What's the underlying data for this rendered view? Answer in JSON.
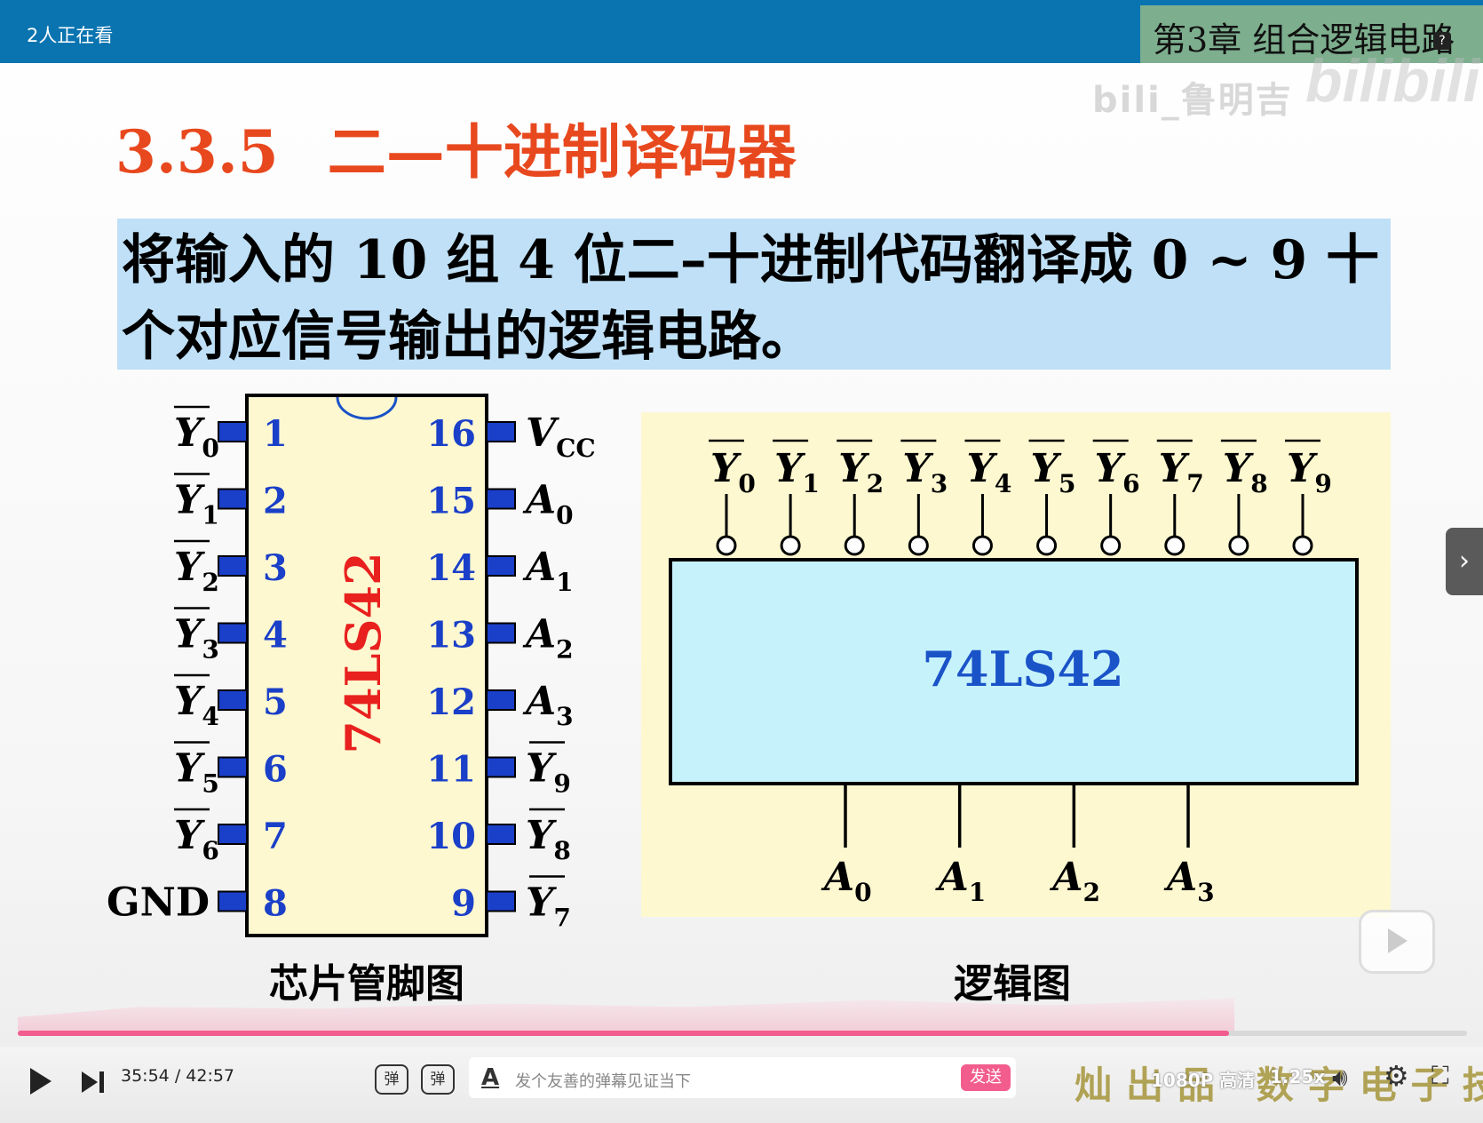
{
  "topbar": {
    "viewer_count": "2人正在看",
    "chapter_title": "第3章 组合逻辑电路",
    "watermark": "bili_鲁明吉",
    "logo": "bilibili"
  },
  "slide": {
    "section_number": "3.3.5",
    "section_title": "二—十进制译码器",
    "definition": "将输入的 10 组 4 位二–十进制代码翻译成 0 ~ 9 十个对应信号输出的逻辑电路。",
    "chip_label": "74LS42",
    "block_label": "74LS42",
    "pinout_caption": "芯片管脚图",
    "logic_caption": "逻辑图",
    "left_pins": [
      {
        "num": "1",
        "base": "Y",
        "sub": "0",
        "bar": true
      },
      {
        "num": "2",
        "base": "Y",
        "sub": "1",
        "bar": true
      },
      {
        "num": "3",
        "base": "Y",
        "sub": "2",
        "bar": true
      },
      {
        "num": "4",
        "base": "Y",
        "sub": "3",
        "bar": true
      },
      {
        "num": "5",
        "base": "Y",
        "sub": "4",
        "bar": true
      },
      {
        "num": "6",
        "base": "Y",
        "sub": "5",
        "bar": true
      },
      {
        "num": "7",
        "base": "Y",
        "sub": "6",
        "bar": true
      },
      {
        "num": "8",
        "base": "GND",
        "sub": "",
        "bar": false
      }
    ],
    "right_pins": [
      {
        "num": "16",
        "base": "V",
        "sub": "CC",
        "bar": false
      },
      {
        "num": "15",
        "base": "A",
        "sub": "0",
        "bar": false
      },
      {
        "num": "14",
        "base": "A",
        "sub": "1",
        "bar": false
      },
      {
        "num": "13",
        "base": "A",
        "sub": "2",
        "bar": false
      },
      {
        "num": "12",
        "base": "A",
        "sub": "3",
        "bar": false
      },
      {
        "num": "11",
        "base": "Y",
        "sub": "9",
        "bar": true
      },
      {
        "num": "10",
        "base": "Y",
        "sub": "8",
        "bar": true
      },
      {
        "num": "9",
        "base": "Y",
        "sub": "7",
        "bar": true
      }
    ],
    "logic_outputs": [
      {
        "base": "Y",
        "sub": "0"
      },
      {
        "base": "Y",
        "sub": "1"
      },
      {
        "base": "Y",
        "sub": "2"
      },
      {
        "base": "Y",
        "sub": "3"
      },
      {
        "base": "Y",
        "sub": "4"
      },
      {
        "base": "Y",
        "sub": "5"
      },
      {
        "base": "Y",
        "sub": "6"
      },
      {
        "base": "Y",
        "sub": "7"
      },
      {
        "base": "Y",
        "sub": "8"
      },
      {
        "base": "Y",
        "sub": "9"
      }
    ],
    "logic_inputs": [
      {
        "base": "A",
        "sub": "0"
      },
      {
        "base": "A",
        "sub": "1"
      },
      {
        "base": "A",
        "sub": "2"
      },
      {
        "base": "A",
        "sub": "3"
      }
    ]
  },
  "player": {
    "current_time": "35:54",
    "duration": "42:57",
    "progress": 0.836,
    "danmaku_toggle_icon": "弹",
    "danmaku_settings_icon": "弹",
    "input_placeholder": "发个友善的弹幕见证当下",
    "send_label": "发送",
    "course_watermark": "灿出品 数字电子技术",
    "quality": "1080P 高清",
    "speed": "1.25x"
  },
  "colors": {
    "topbar": "#0a74b0",
    "section_title": "#e8481e",
    "definition_bg": "#bfe0f6",
    "chip_fill": "#fdf8d0",
    "chip_label": "#e8201e",
    "pin_number": "#1a3fc8",
    "pin_stub": "#1a3fc8",
    "logic_panel": "#fdf8d0",
    "logic_block": "#c6f2fb",
    "block_label": "#1a53c8",
    "accent": "#f25d8e"
  }
}
